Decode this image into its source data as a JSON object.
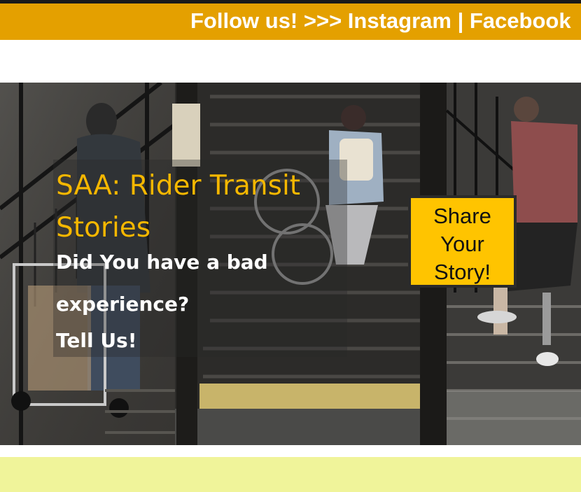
{
  "banner": {
    "text": "Follow us! >>> Instagram | Facebook"
  },
  "hero": {
    "title": "SAA: Rider Transit Stories",
    "line1": "Did You have a bad",
    "line2": "experience?",
    "line3": "Tell Us!"
  },
  "cta": {
    "label": "Share Your Story!"
  },
  "colors": {
    "banner": "#e4a000",
    "title": "#f5b700",
    "cta": "#ffc400",
    "bottom_band": "#f0f49a"
  }
}
